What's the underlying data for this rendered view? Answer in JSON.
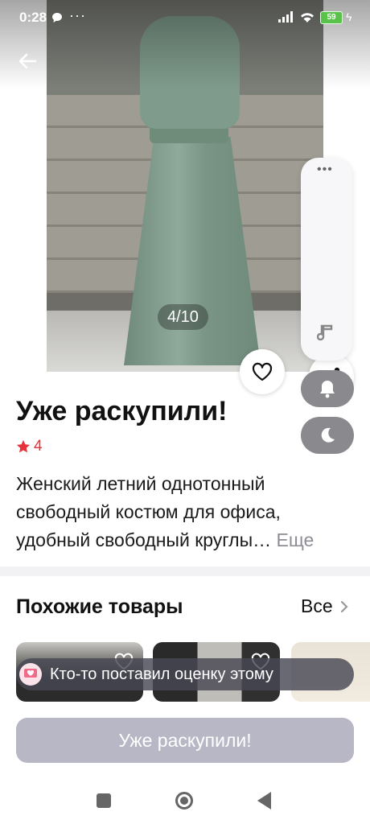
{
  "status_bar": {
    "time": "0:28",
    "battery": "59"
  },
  "gallery": {
    "counter": "4/10"
  },
  "product": {
    "title": "Уже раскупили!",
    "rating": "4",
    "description": "Женский летний однотонный свободный костюм для офиса, удобный свободный круглы…",
    "more_label": "Еще"
  },
  "similar": {
    "title": "Похожие товары",
    "all_label": "Все"
  },
  "toast": {
    "text": "Кто-то поставил оценку этому"
  },
  "action": {
    "sold_out_label": "Уже раскупили!"
  },
  "colors": {
    "accent_red": "#e8323a",
    "button_disabled": "#b7b7c6"
  },
  "icons": [
    "back-arrow-icon",
    "heart-icon",
    "share-icon",
    "star-icon",
    "chevron-right-icon",
    "music-note-icon",
    "bell-icon",
    "moon-icon",
    "chat-bubble-icon",
    "wifi-icon",
    "signal-icon",
    "battery-icon"
  ]
}
